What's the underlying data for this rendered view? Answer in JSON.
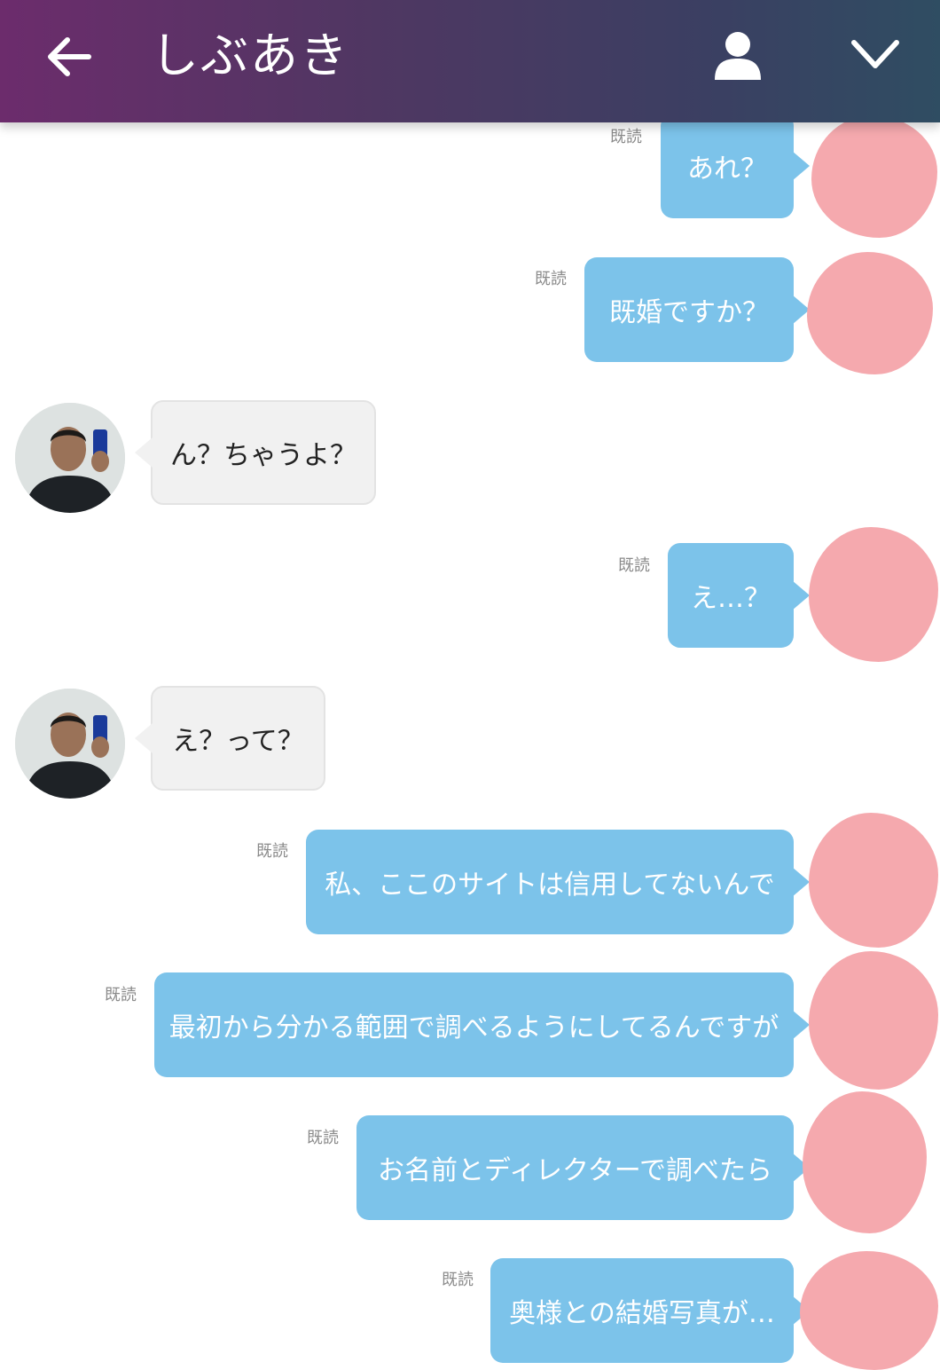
{
  "header": {
    "title": "しぶあき",
    "back_icon": "arrow-left-icon",
    "profile_icon": "person-icon",
    "menu_icon": "chevron-down-icon"
  },
  "colors": {
    "header_start": "#6c2c6c",
    "header_end": "#2f4d62",
    "sent_bubble": "#7cc3ea",
    "received_bubble": "#f1f1f1",
    "avatar_redaction": "#f5a9ae"
  },
  "messages": [
    {
      "direction": "sent",
      "text": "あれ？",
      "read": "既読"
    },
    {
      "direction": "sent",
      "text": "既婚ですか？",
      "read": "既読"
    },
    {
      "direction": "received",
      "text": "ん？ちゃうよ？"
    },
    {
      "direction": "sent",
      "text": "え…？",
      "read": "既読"
    },
    {
      "direction": "received",
      "text": "え？って？"
    },
    {
      "direction": "sent",
      "text": "私、ここのサイトは信用してないんで",
      "read": "既読"
    },
    {
      "direction": "sent",
      "text": "最初から分かる範囲で調べるようにしてるんですが",
      "read": "既読"
    },
    {
      "direction": "sent",
      "text": "お名前とディレクターで調べたら",
      "read": "既読"
    },
    {
      "direction": "sent",
      "text": "奥様との結婚写真が…",
      "read": "既読"
    }
  ]
}
